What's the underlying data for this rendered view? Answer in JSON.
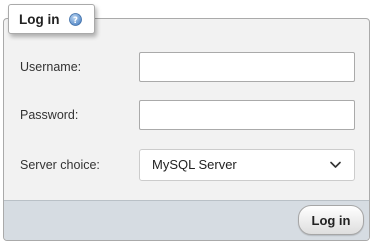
{
  "login_form": {
    "legend": "Log in",
    "help_icon": "help-icon",
    "fields": {
      "username": {
        "label": "Username:",
        "value": "",
        "placeholder": ""
      },
      "password": {
        "label": "Password:",
        "value": "",
        "placeholder": ""
      },
      "server": {
        "label": "Server choice:",
        "selected": "MySQL Server",
        "options": [
          "MySQL Server"
        ]
      }
    },
    "submit_label": "Log in"
  },
  "colors": {
    "panel_bg": "#f2f2f2",
    "footer_bg": "#d6dce2",
    "help_icon": "#5b8fc9",
    "border": "#aaaaaa"
  },
  "icons": {
    "help": "help-icon",
    "select_arrow": "chevron-down-icon"
  }
}
